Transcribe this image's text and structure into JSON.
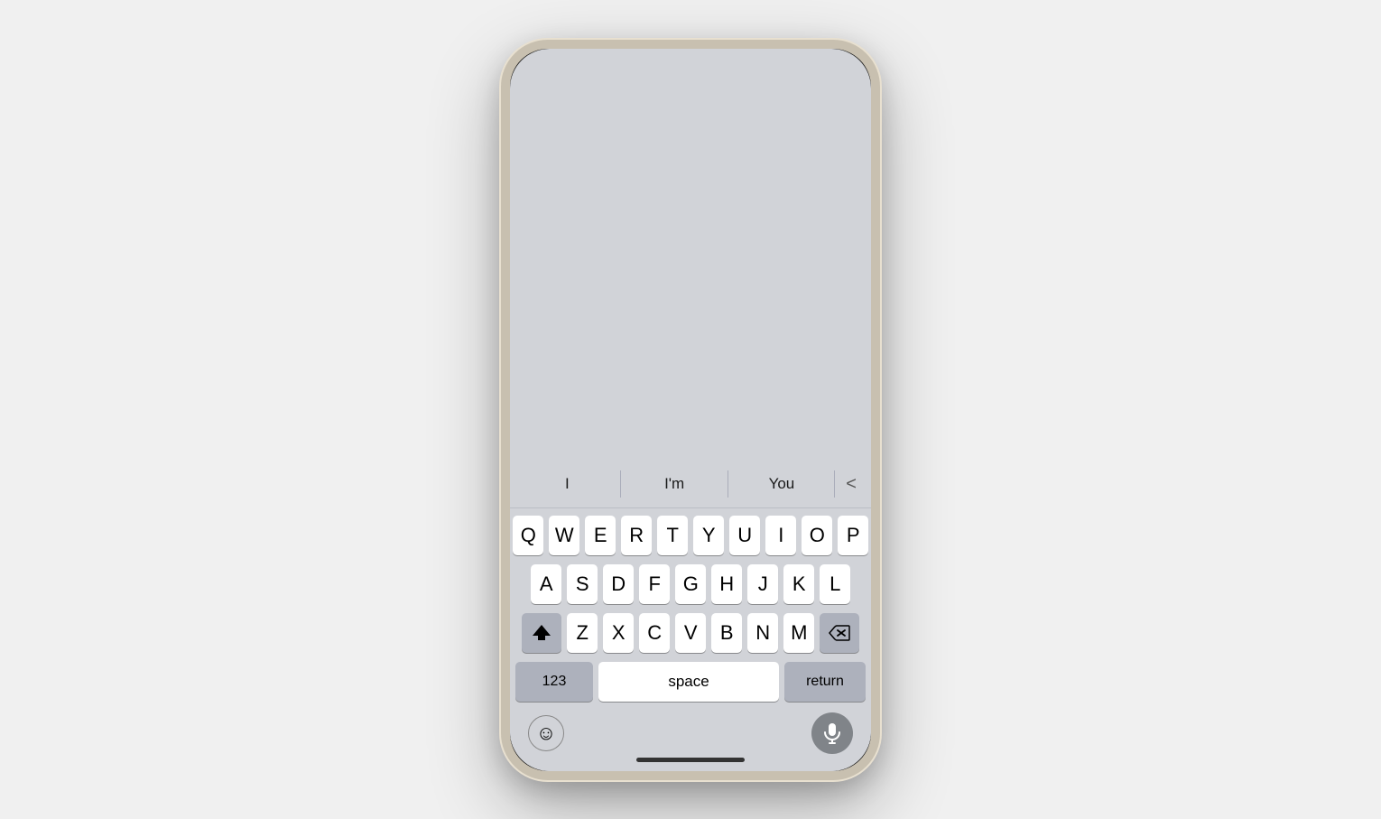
{
  "autocomplete": {
    "items": [
      "I",
      "I'm",
      "You"
    ],
    "chevron": "<"
  },
  "keyboard": {
    "rows": [
      [
        "Q",
        "W",
        "E",
        "R",
        "T",
        "Y",
        "U",
        "I",
        "O",
        "P"
      ],
      [
        "A",
        "S",
        "D",
        "F",
        "G",
        "H",
        "J",
        "K",
        "L"
      ],
      [
        "Z",
        "X",
        "C",
        "V",
        "B",
        "N",
        "M"
      ]
    ],
    "bottom": {
      "numbers_label": "123",
      "space_label": "space",
      "return_label": "return"
    }
  },
  "colors": {
    "keyboard_bg": "#d1d3d8",
    "key_white": "#ffffff",
    "key_gray": "#adb1bc",
    "text_dark": "#000000",
    "mic_bg": "#808489"
  }
}
